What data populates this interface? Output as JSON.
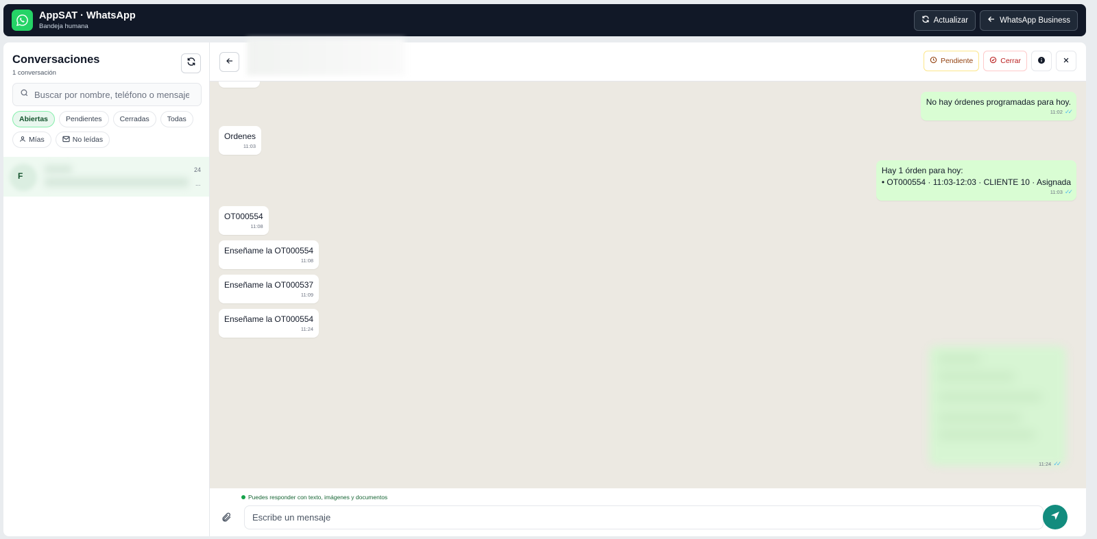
{
  "topbar": {
    "app_title": "AppSAT · WhatsApp",
    "app_subtitle": "Bandeja humana",
    "refresh_label": "Actualizar",
    "business_label": "WhatsApp Business",
    "logo_icon": "whatsapp-icon",
    "brand_color": "#25d366"
  },
  "sidebar": {
    "title": "Conversaciones",
    "count_label": "1 conversación",
    "search_placeholder": "Buscar por nombre, teléfono o mensaje",
    "status_filters": [
      "Abiertas",
      "Pendientes",
      "Cerradas",
      "Todas"
    ],
    "active_filter": "Abiertas",
    "extra_filters": [
      "Mías",
      "No leídas"
    ],
    "conversation": {
      "initial": "F",
      "time": "24",
      "ellipsis": "..."
    }
  },
  "chat_header": {
    "pending_label": "Pendiente",
    "close_label": "Cerrar"
  },
  "messages": [
    {
      "direction": "out",
      "text": "No hay órdenes programadas para hoy.",
      "time": "11:02"
    },
    {
      "direction": "in",
      "text": "Ordenes",
      "time": "11:03"
    },
    {
      "direction": "out",
      "lines": [
        "Hay 1 órden para hoy:",
        "• OT000554 · 11:03-12:03 · CLIENTE 10 · Asignada"
      ],
      "time": "11:03"
    },
    {
      "direction": "in",
      "text": "OT000554",
      "time": "11:08"
    },
    {
      "direction": "in",
      "text": "Enseñame la OT000554",
      "time": "11:08"
    },
    {
      "direction": "in",
      "text": "Enseñame la OT000537",
      "time": "11:09"
    },
    {
      "direction": "in",
      "text": "Enseñame la OT000554",
      "time": "11:24"
    },
    {
      "direction": "out",
      "text": "",
      "time": "11:24",
      "blurred": true
    }
  ],
  "composer": {
    "hint": "Puedes responder con texto, imágenes y documentos",
    "placeholder": "Escribe un mensaje"
  },
  "colors": {
    "header_bg": "#111827",
    "incoming_bubble": "#ffffff",
    "outgoing_bubble": "#d9fdd3",
    "chat_bg": "#ece9e2",
    "send_button": "#128c7e"
  }
}
